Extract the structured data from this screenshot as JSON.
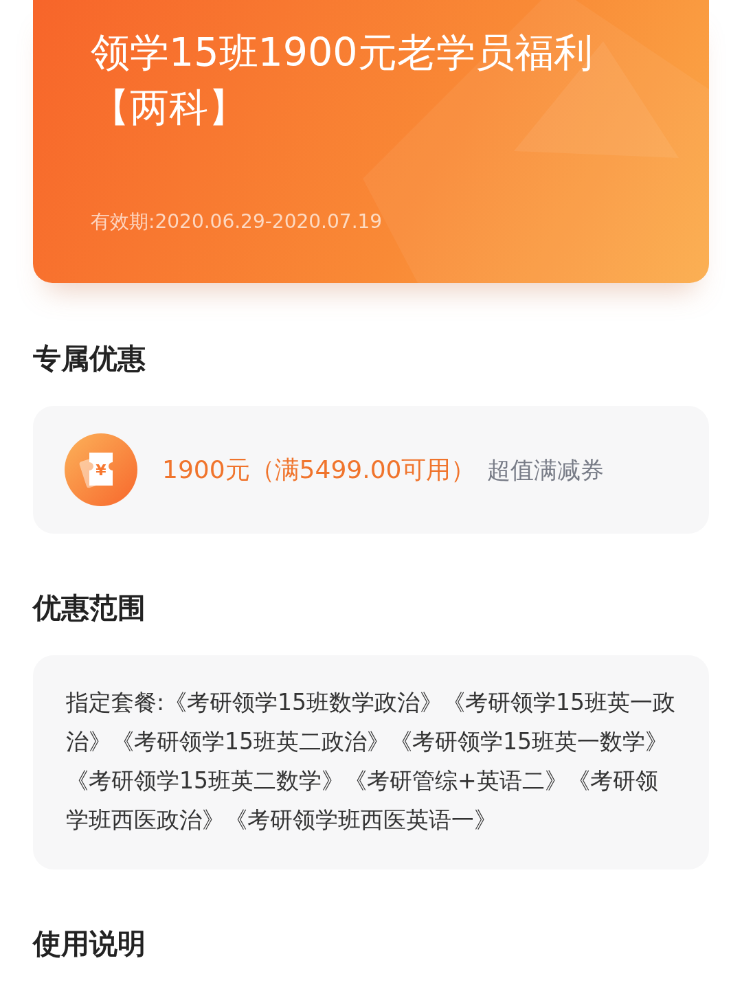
{
  "banner": {
    "title": "领学15班1900元老学员福利【两科】",
    "validity": "有效期:2020.06.29-2020.07.19"
  },
  "sections": [
    {
      "kind": "coupon",
      "heading": "专属优惠",
      "icon_symbol": "¥",
      "amount": "1900元（满5499.00可用）",
      "label": "超值满减券"
    },
    {
      "kind": "text",
      "heading": "优惠范围",
      "body": "指定套餐:《考研领学15班数学政治》《考研领学15班英一政治》《考研领学15班英二政治》《考研领学15班英一数学》《考研领学15班英二数学》《考研管综+英语二》《考研领学班西医政治》《考研领学班西医英语一》"
    },
    {
      "kind": "heading",
      "heading": "使用说明"
    }
  ]
}
